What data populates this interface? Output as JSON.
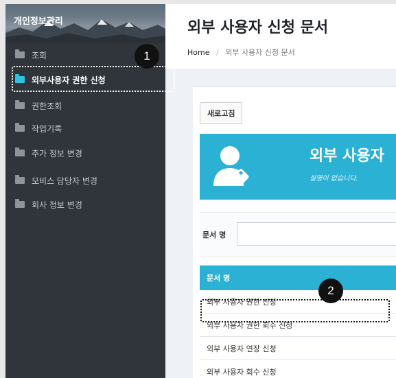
{
  "sidebar": {
    "title": "개인정보관리",
    "items": [
      {
        "label": "조회",
        "active": false
      },
      {
        "label": "외부사용자 권한 신청",
        "active": true
      },
      {
        "label": "권한조회",
        "active": false
      },
      {
        "label": "작업기록",
        "active": false
      },
      {
        "label": "추가 정보 변경",
        "active": false
      },
      {
        "label": "모비스 담당자 변경",
        "active": false
      },
      {
        "label": "회사 정보 변경",
        "active": false
      }
    ]
  },
  "header": {
    "title": "외부 사용자 신청 문서",
    "breadcrumb": {
      "home": "Home",
      "separator": "/",
      "current": "외부 사용자 신청 문서"
    }
  },
  "toolbar": {
    "refresh_label": "새로고침"
  },
  "banner": {
    "title": "외부 사용자",
    "subtitle": "설명이 없습니다."
  },
  "filter": {
    "label": "문서 명",
    "value": ""
  },
  "table": {
    "header": "문서 명",
    "rows": [
      "외부 사용자 권한 신청",
      "외부 사용자 권한 회수 신청",
      "외부 사용자 연장 신청",
      "외부 사용자 회수 신청"
    ]
  },
  "annotations": {
    "callout_1": "1",
    "callout_2": "2"
  },
  "colors": {
    "sidebar_bg": "#2f353a",
    "accent": "#2bb1d4",
    "active_folder": "#2ec4e0"
  }
}
